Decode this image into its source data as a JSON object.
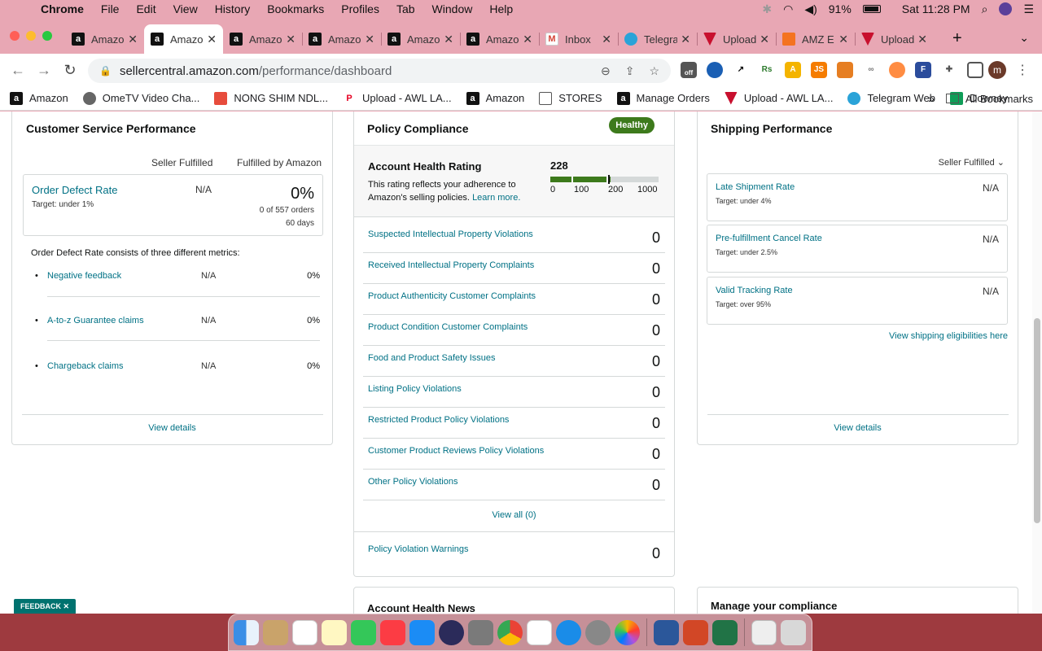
{
  "menubar": {
    "app": "Chrome",
    "items": [
      "File",
      "Edit",
      "View",
      "History",
      "Bookmarks",
      "Profiles",
      "Tab",
      "Window",
      "Help"
    ],
    "battery": "91%",
    "clock": "Sat 11:28 PM"
  },
  "tabs": [
    {
      "title": "Amazon",
      "favicon": "amazon-icon",
      "active": false
    },
    {
      "title": "Amazon",
      "favicon": "amazon-icon",
      "active": true
    },
    {
      "title": "Amazon",
      "favicon": "amazon-icon",
      "active": false
    },
    {
      "title": "Amazon",
      "favicon": "amazon-icon",
      "active": false
    },
    {
      "title": "Amazon",
      "favicon": "amazon-icon",
      "active": false
    },
    {
      "title": "Amazon",
      "favicon": "amazon-icon",
      "active": false
    },
    {
      "title": "Inbox",
      "favicon": "gmail-icon",
      "active": false
    },
    {
      "title": "Telegram",
      "favicon": "telegram-icon",
      "active": false
    },
    {
      "title": "Upload",
      "favicon": "shield-icon",
      "active": false
    },
    {
      "title": "AMZ E",
      "favicon": "amz-icon",
      "active": false
    },
    {
      "title": "Upload",
      "favicon": "shield-icon",
      "active": false
    }
  ],
  "toolbar": {
    "url_domain": "sellercentral.amazon.com",
    "url_path": "/performance/dashboard",
    "profile_initial": "m",
    "badge_off": "off"
  },
  "bookmarks": [
    {
      "label": "Amazon",
      "icon": "amazon-icon"
    },
    {
      "label": "OmeTV Video Cha...",
      "icon": "globe-icon"
    },
    {
      "label": "NONG SHIM NDL...",
      "icon": "gift-icon"
    },
    {
      "label": "Upload - AWL LA...",
      "icon": "pinterest-icon"
    },
    {
      "label": "Amazon",
      "icon": "amazon-icon"
    },
    {
      "label": "STORES",
      "icon": "folder-icon"
    },
    {
      "label": "Manage Orders",
      "icon": "amazon-icon"
    },
    {
      "label": "Upload - AWL LA...",
      "icon": "shield-icon"
    },
    {
      "label": "Telegram Web",
      "icon": "telegram-icon"
    },
    {
      "label": "Downey",
      "icon": "sheets-icon"
    }
  ],
  "bookmarks_overflow": "»",
  "bookmarks_all": "All Bookmarks",
  "customer_service": {
    "title": "Customer Service Performance",
    "col_seller": "Seller Fulfilled",
    "col_fba": "Fulfilled by Amazon",
    "odr": {
      "name": "Order Defect Rate",
      "target": "Target: under 1%",
      "seller_value": "N/A",
      "fba_value": "0%",
      "orders": "0 of 557 orders",
      "days": "60 days"
    },
    "description": "Order Defect Rate consists of three different metrics:",
    "metrics": [
      {
        "name": "Negative feedback",
        "seller": "N/A",
        "fba": "0%"
      },
      {
        "name": "A-to-z Guarantee claims",
        "seller": "N/A",
        "fba": "0%"
      },
      {
        "name": "Chargeback claims",
        "seller": "N/A",
        "fba": "0%"
      }
    ],
    "view_details": "View details"
  },
  "policy": {
    "title": "Policy Compliance",
    "status": "Healthy",
    "ahr_title": "Account Health Rating",
    "ahr_desc_1": "This rating reflects your adherence to Amazon's selling policies.",
    "ahr_learn_more": "Learn more.",
    "ahr_score": "228",
    "ahr_ticks": [
      "0",
      "100",
      "200",
      "1000"
    ],
    "rows": [
      {
        "name": "Suspected Intellectual Property Violations",
        "value": "0"
      },
      {
        "name": "Received Intellectual Property Complaints",
        "value": "0"
      },
      {
        "name": "Product Authenticity Customer Complaints",
        "value": "0"
      },
      {
        "name": "Product Condition Customer Complaints",
        "value": "0"
      },
      {
        "name": "Food and Product Safety Issues",
        "value": "0"
      },
      {
        "name": "Listing Policy Violations",
        "value": "0"
      },
      {
        "name": "Restricted Product Policy Violations",
        "value": "0"
      },
      {
        "name": "Customer Product Reviews Policy Violations",
        "value": "0"
      },
      {
        "name": "Other Policy Violations",
        "value": "0"
      }
    ],
    "view_all": "View all (0)",
    "warnings_label": "Policy Violation Warnings",
    "warnings_value": "0"
  },
  "shipping": {
    "title": "Shipping Performance",
    "filter": "Seller Fulfilled ⌄",
    "metrics": [
      {
        "name": "Late Shipment Rate",
        "target": "Target: under 4%",
        "value": "N/A"
      },
      {
        "name": "Pre-fulfillment Cancel Rate",
        "target": "Target: under 2.5%",
        "value": "N/A"
      },
      {
        "name": "Valid Tracking Rate",
        "target": "Target: over 95%",
        "value": "N/A"
      }
    ],
    "eligibilities": "View shipping eligibilities here",
    "view_details": "View details"
  },
  "bottom": {
    "news_title": "Account Health News",
    "compliance_title": "Manage your compliance"
  },
  "feedback": "FEEDBACK ✕",
  "colors": {
    "link": "#007185",
    "healthy": "#3d7a1c",
    "menubar": "#e8a7b4"
  }
}
